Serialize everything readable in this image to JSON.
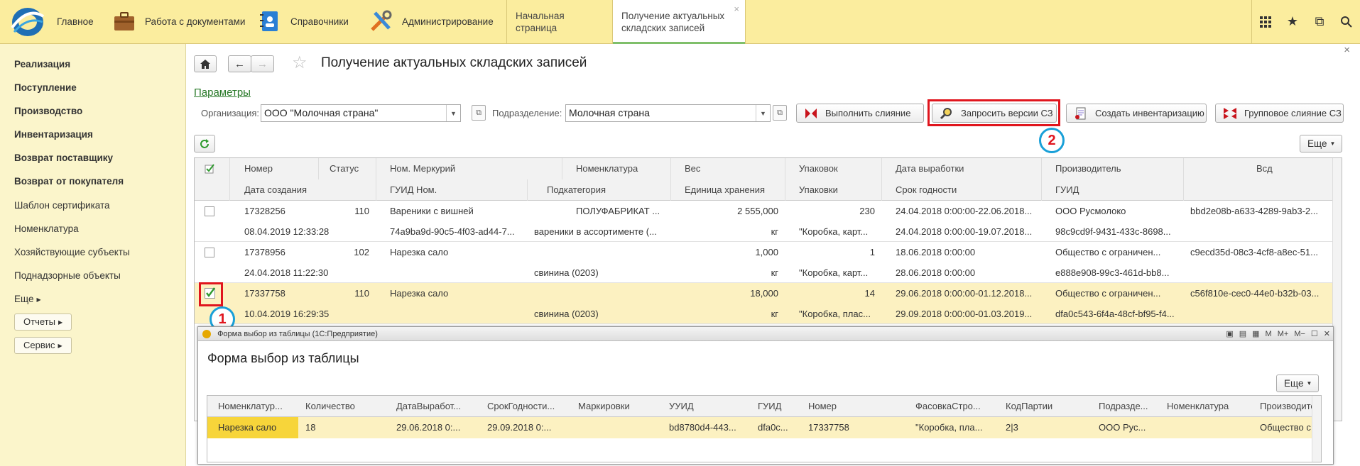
{
  "topbar": {
    "sections": [
      {
        "label": "Главное",
        "icon": "1c-logo-icon"
      },
      {
        "label": "Работа с документами",
        "icon": "briefcase-icon"
      },
      {
        "label": "Справочники",
        "icon": "address-book-icon"
      },
      {
        "label": "Администрирование",
        "icon": "tools-icon"
      }
    ],
    "tabs": [
      {
        "label": "Начальная страница"
      },
      {
        "label_line1": "Получение актуальных",
        "label_line2": "складских записей",
        "close": "×"
      }
    ],
    "right_icons": [
      "grid-menu-icon",
      "star-icon",
      "history-icon",
      "search-icon"
    ],
    "right_glyphs": [
      "⋮⋮⋮",
      "★",
      "⧉",
      "🔍"
    ]
  },
  "sidebar": {
    "items": [
      {
        "label": "Реализация",
        "bold": true
      },
      {
        "label": "Поступление",
        "bold": true
      },
      {
        "label": "Производство",
        "bold": true
      },
      {
        "label": "Инвентаризация",
        "bold": true
      },
      {
        "label": "Возврат поставщику",
        "bold": true
      },
      {
        "label": "Возврат от покупателя",
        "bold": true
      },
      {
        "label": "Шаблон сертификата",
        "bold": false
      },
      {
        "label": "Номенклатура",
        "bold": false
      },
      {
        "label": "Хозяйствующие субъекты",
        "bold": false
      },
      {
        "label": "Поднадзорные объекты",
        "bold": false
      }
    ],
    "more_label": "Еще",
    "buttons": [
      {
        "label": "Отчеты"
      },
      {
        "label": "Сервис"
      }
    ]
  },
  "page": {
    "title": "Получение актуальных складских записей",
    "close": "×",
    "params_link": "Параметры",
    "org_label": "Организация:",
    "org_value": "ООО \"Молочная страна\"",
    "dept_label": "Подразделение:",
    "dept_value": "Молочная страна",
    "actions": {
      "merge": "Выполнить слияние",
      "request": "Запросить версии СЗ",
      "inventory": "Создать инвентаризацию",
      "group_merge": "Групповое слияние СЗ"
    },
    "more": "Еще",
    "badge1": "1",
    "badge2": "2"
  },
  "grid": {
    "header_top": [
      "Номер",
      "Статус",
      "Ном. Меркурий",
      "Номенклатура",
      "Вес",
      "Упаковок",
      "Дата выработки",
      "Производитель",
      "Всд"
    ],
    "header_bottom": [
      "Дата создания",
      "ГУИД Ном.",
      "Подкатегория",
      "Единица хранения",
      "Упаковки",
      "Срок годности",
      "ГУИД"
    ],
    "rows": [
      {
        "checked": false,
        "top": [
          "17328256",
          "110",
          "Вареники с вишней",
          "ПОЛУФАБРИКАТ ...",
          "2 555,000",
          "230",
          "24.04.2018 0:00:00-22.06.2018...",
          "ООО Русмолоко",
          "bbd2e08b-a633-4289-9ab3-2..."
        ],
        "bottom": [
          "08.04.2019 12:33:28",
          "74a9ba9d-90c5-4f03-ad44-7...",
          "вареники в ассортименте (...",
          "кг",
          "\"Коробка, карт...",
          "24.04.2018 0:00:00-19.07.2018...",
          "98c9cd9f-9431-433c-8698..."
        ]
      },
      {
        "checked": false,
        "top": [
          "17378956",
          "102",
          "Нарезка сало",
          "",
          "1,000",
          "1",
          "18.06.2018 0:00:00",
          "Общество с ограничен...",
          "c9ecd35d-08c3-4cf8-a8ec-51..."
        ],
        "bottom": [
          "24.04.2018 11:22:30",
          "",
          "свинина (0203)",
          "кг",
          "\"Коробка, карт...",
          "28.06.2018 0:00:00",
          "e888e908-99c3-461d-bb8..."
        ]
      },
      {
        "checked": true,
        "top": [
          "17337758",
          "110",
          "Нарезка сало",
          "",
          "18,000",
          "14",
          "29.06.2018 0:00:00-01.12.2018...",
          "Общество с ограничен...",
          "c56f810e-cec0-44e0-b32b-03..."
        ],
        "bottom": [
          "10.04.2019 16:29:35",
          "",
          "свинина (0203)",
          "кг",
          "\"Коробка, плас...",
          "29.09.2018 0:00:00-01.03.2019...",
          "dfa0c543-6f4a-48cf-bf95-f4..."
        ]
      }
    ]
  },
  "popup": {
    "window_title": "Форма выбор из таблицы  (1С:Предприятие)",
    "title_icons": [
      "pin-icon",
      "doc-icon",
      "calc-icon",
      "M",
      "M+",
      "M-",
      "restore-icon",
      "close-icon"
    ],
    "title_glyphs": [
      "▣",
      "▤",
      "▦",
      "M",
      "M+",
      "M−",
      "☐",
      "✕"
    ],
    "form_title": "Форма выбор из таблицы",
    "more": "Еще",
    "columns": [
      "Номенклатур...",
      "Количество",
      "ДатаВыработ...",
      "СрокГодности...",
      "Маркировки",
      "УУИД",
      "ГУИД",
      "Номер",
      "ФасовкаСтро...",
      "КодПартии",
      "Подразде...",
      "Номенклатура",
      "Производите"
    ],
    "row": [
      "Нарезка сало",
      "18",
      "29.06.2018 0:...",
      "29.09.2018 0:...",
      "",
      "bd8780d4-443...",
      "dfa0c...",
      "17337758",
      "\"Коробка, пла...",
      "2|3",
      "ООО Рус...",
      "",
      "Общество с"
    ]
  }
}
